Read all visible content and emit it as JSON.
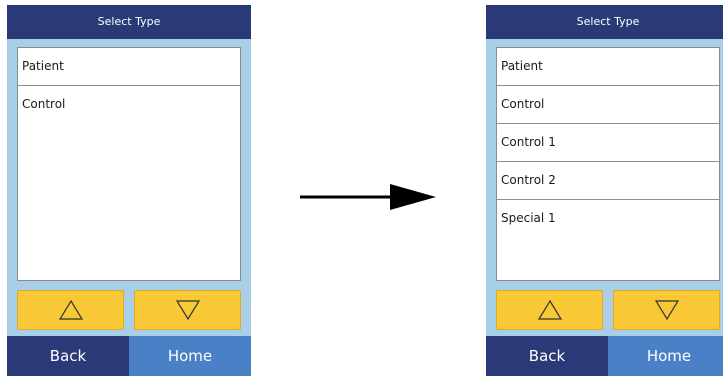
{
  "left_screen": {
    "title": "Select Type",
    "items": [
      "Patient",
      "Control"
    ],
    "nav": {
      "back": "Back",
      "home": "Home"
    }
  },
  "right_screen": {
    "title": "Select Type",
    "items": [
      "Patient",
      "Control",
      "Control 1",
      "Control 2",
      "Special 1"
    ],
    "nav": {
      "back": "Back",
      "home": "Home"
    }
  },
  "colors": {
    "title_bar": "#2a3a78",
    "screen_bg": "#a9cfe8",
    "arrow_buttons": "#f8c837",
    "home_button": "#4a80c6"
  },
  "icons": {
    "scroll_up": "triangle-up-icon",
    "scroll_down": "triangle-down-icon",
    "transition": "right-arrow-icon"
  }
}
